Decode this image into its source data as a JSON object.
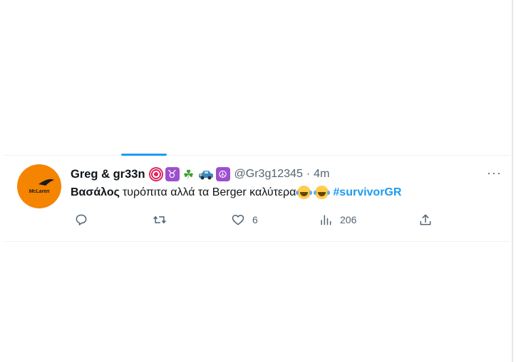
{
  "tweet": {
    "display_name": "Greg & gr33n",
    "name_emojis": [
      "direct-hit-icon",
      "taurus-icon",
      "shamrock-icon",
      "car-icon",
      "peace-icon"
    ],
    "handle": "@Gr3g12345",
    "separator": "·",
    "time": "4m",
    "more_label": "···",
    "text_bold": "Βασάλος",
    "text_body": "τυρόπιτα αλλά τα Berger καλύτερα",
    "hashtag": "#survivorGR",
    "avatar_text": "McLaren",
    "colors": {
      "accent": "#1d9bf0",
      "avatar_bg": "#f58400",
      "secondary_text": "#536471"
    }
  },
  "actions": {
    "reply_count": "",
    "retweet_count": "",
    "like_count": "6",
    "views_count": "206"
  }
}
